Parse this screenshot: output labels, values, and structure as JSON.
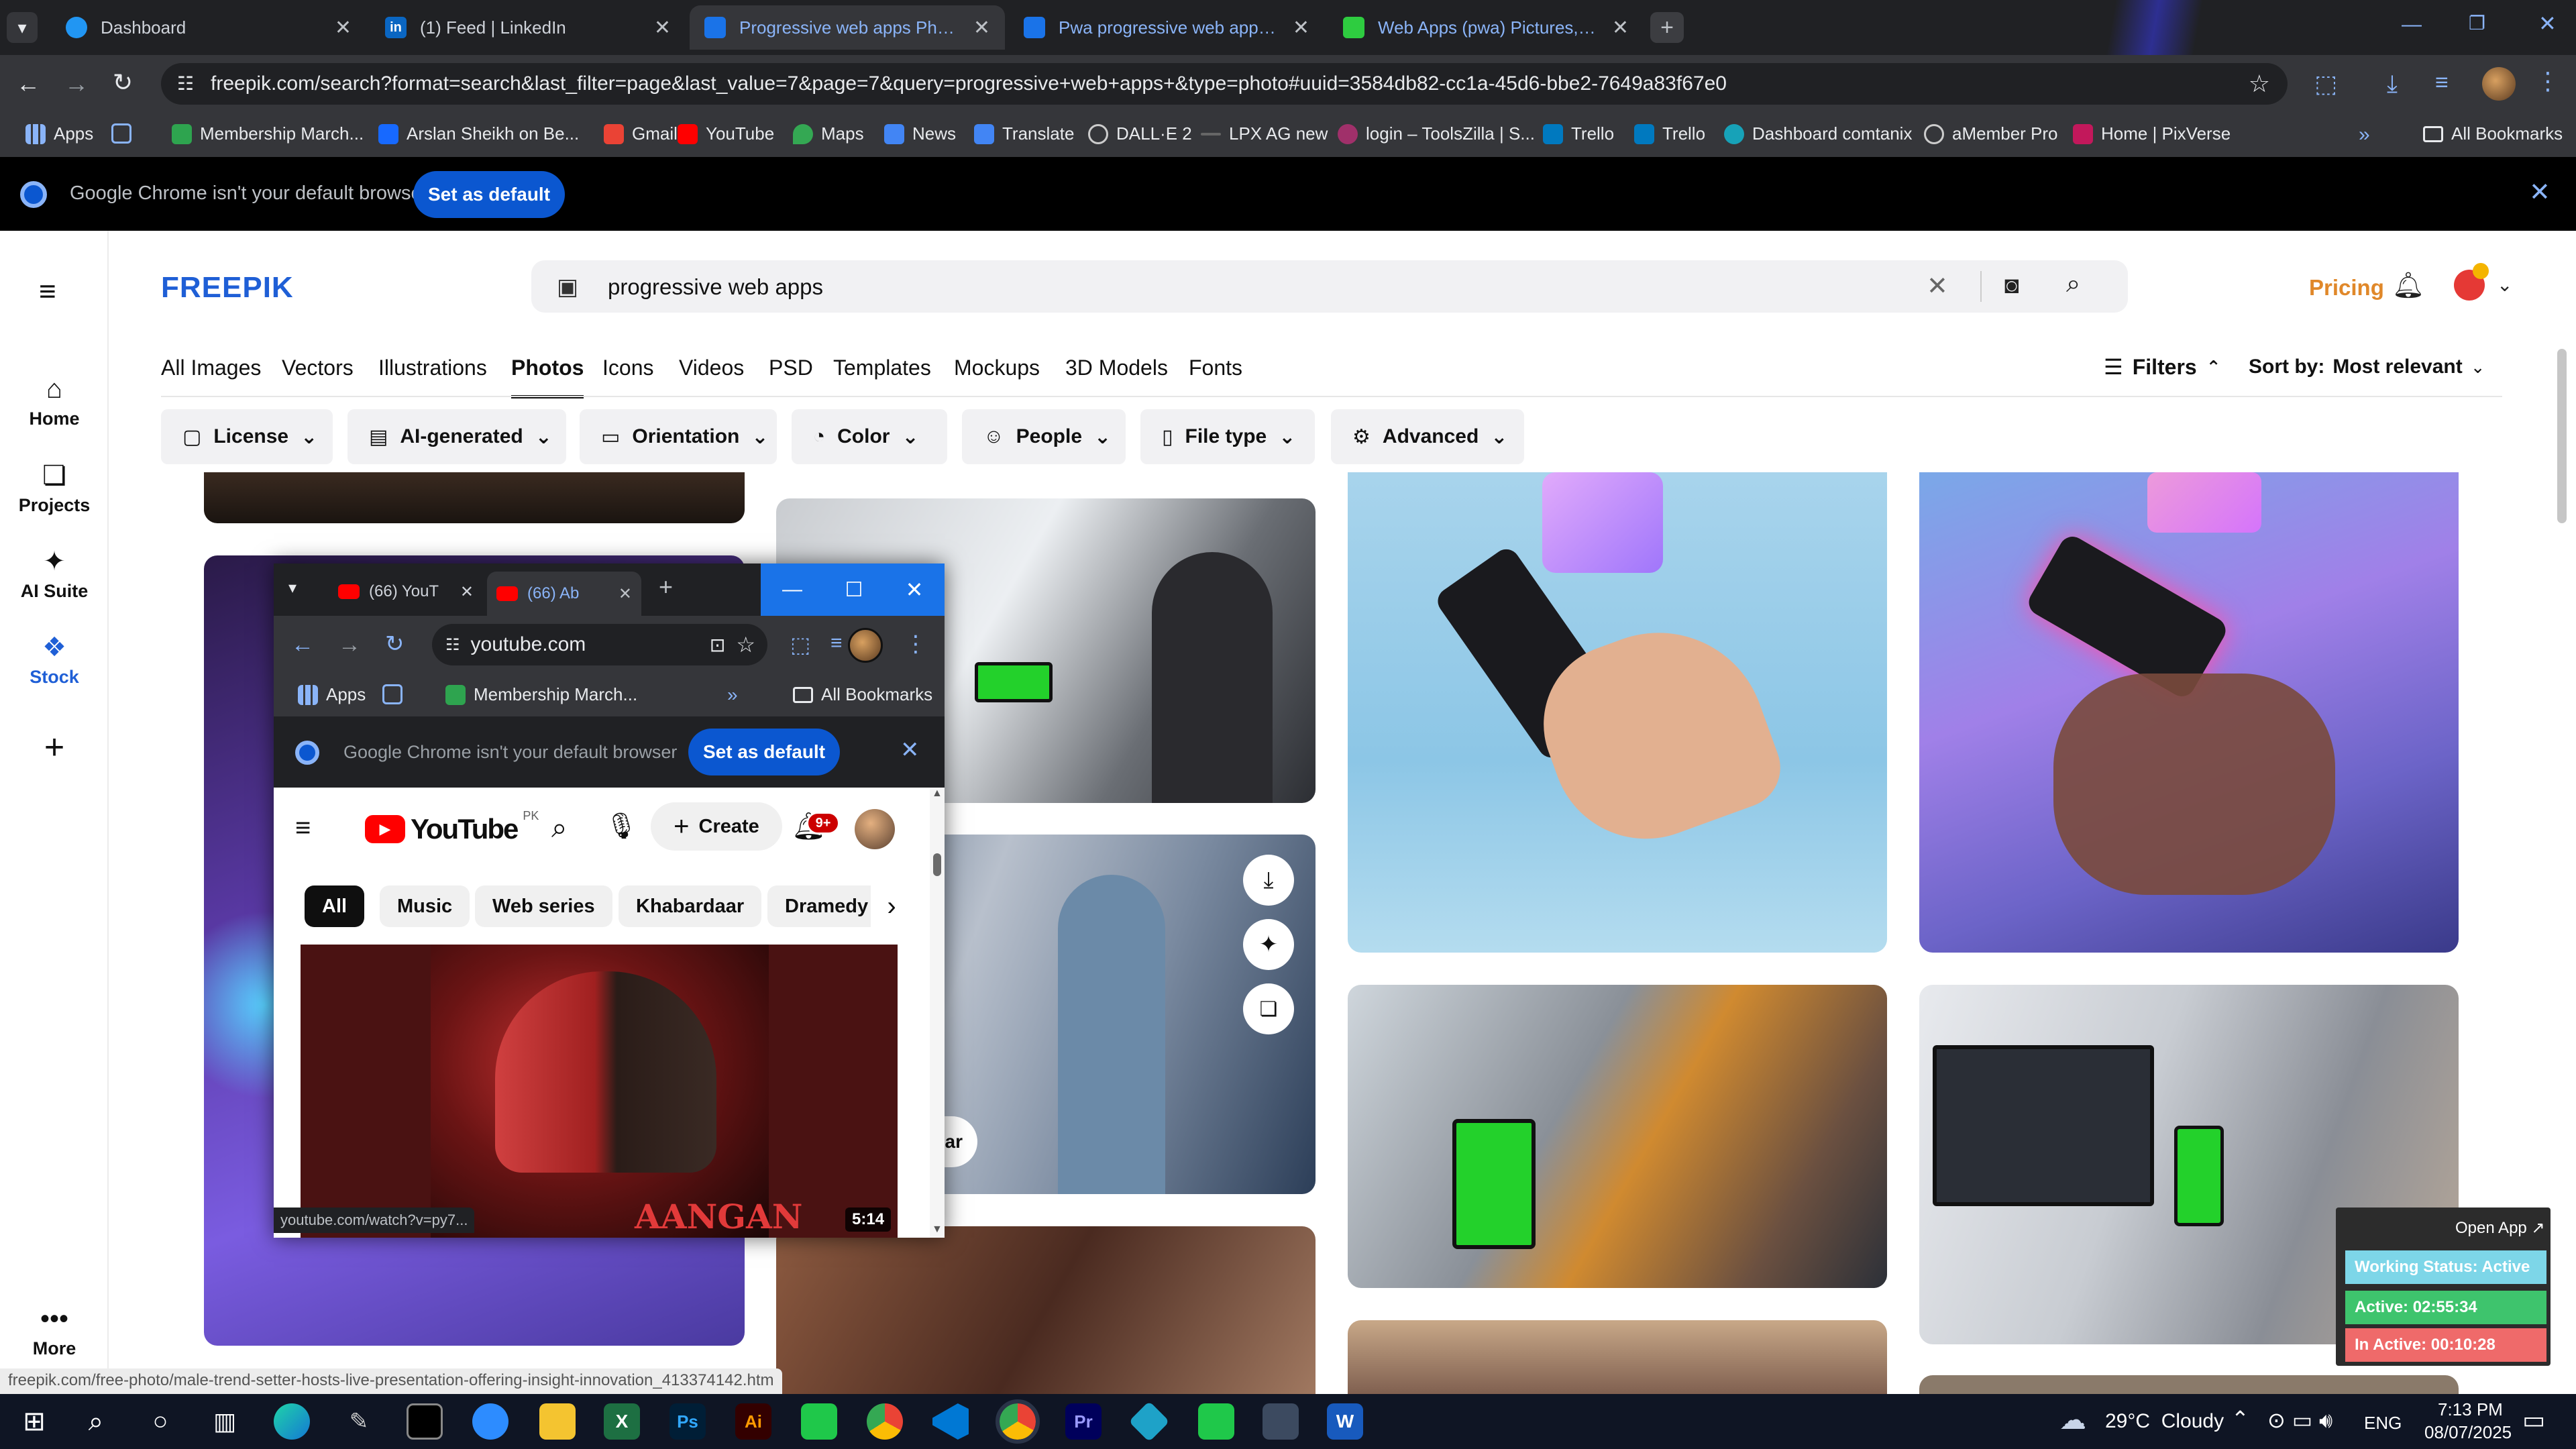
{
  "browser": {
    "tabs": [
      {
        "title": "Dashboard",
        "color": "#2196f3"
      },
      {
        "title": "(1) Feed | LinkedIn",
        "color": "#0a66c2"
      },
      {
        "title": "Progressive web apps Photos | Fr",
        "color": "#1a73e8"
      },
      {
        "title": "Pwa progressive web apps sma",
        "color": "#1a73e8"
      },
      {
        "title": "Web Apps (pwa) Pictures, Imag",
        "color": "#2ecc40"
      }
    ],
    "url": "freepik.com/search?format=search&last_filter=page&last_value=7&page=7&query=progressive+web+apps+&type=photo#uuid=3584db82-cc1a-45d6-bbe2-7649a83f67e0",
    "bookmarks": [
      {
        "label": "Apps",
        "color": "#8ab4f8"
      },
      {
        "label": "",
        "color": "#8ab4f8"
      },
      {
        "label": "Membership March...",
        "color": "#2ea44f"
      },
      {
        "label": "Arslan Sheikh on Be...",
        "color": "#1769ff"
      },
      {
        "label": "Gmail",
        "color": "#ea4335"
      },
      {
        "label": "YouTube",
        "color": "#ff0000"
      },
      {
        "label": "Maps",
        "color": "#34a853"
      },
      {
        "label": "News",
        "color": "#4285f4"
      },
      {
        "label": "Translate",
        "color": "#4285f4"
      },
      {
        "label": "DALL·E 2",
        "color": "#cccccc"
      },
      {
        "label": "LPX AG new",
        "color": "#666666"
      },
      {
        "label": "login – ToolsZilla | S...",
        "color": "#a0306a"
      },
      {
        "label": "Trello",
        "color": "#0079bf"
      },
      {
        "label": "Trello",
        "color": "#0079bf"
      },
      {
        "label": "Dashboard comtanix",
        "color": "#17a2b8"
      },
      {
        "label": "aMember Pro",
        "color": "#999999"
      },
      {
        "label": "Home | PixVerse",
        "color": "#c2185b"
      }
    ],
    "all_bookmarks": "All Bookmarks",
    "infobar_text": "Google Chrome isn't your default browser",
    "set_default": "Set as default"
  },
  "freepik": {
    "logo": "FREEPIK",
    "search_value": "progressive web apps",
    "pricing": "Pricing",
    "rail": [
      {
        "label": "Home",
        "icon": "home-icon"
      },
      {
        "label": "Projects",
        "icon": "projects-icon"
      },
      {
        "label": "AI Suite",
        "icon": "ai-suite-icon"
      },
      {
        "label": "Stock",
        "icon": "stock-icon"
      },
      {
        "label": "",
        "icon": "plus-icon"
      },
      {
        "label": "More",
        "icon": "more-icon"
      }
    ],
    "categories": [
      "All Images",
      "Vectors",
      "Illustrations",
      "Photos",
      "Icons",
      "Videos",
      "PSD",
      "Templates",
      "Mockups",
      "3D Models",
      "Fonts"
    ],
    "active_category": "Photos",
    "filters_label": "Filters",
    "sort_label": "Sort by:",
    "sort_value": "Most relevant",
    "filter_chips": [
      "License",
      "AI-generated",
      "Orientation",
      "Color",
      "People",
      "File type",
      "Advanced"
    ],
    "hover_similar": "ilar",
    "status_url": "freepik.com/free-photo/male-trend-setter-hosts-live-presentation-offering-insight-innovation_413374142.htm"
  },
  "youtube_window": {
    "tabs": [
      "(66) YouT",
      "(66) Ab"
    ],
    "url": "youtube.com",
    "bookmarks": [
      "Apps",
      "Membership March..."
    ],
    "all_bookmarks": "All Bookmarks",
    "infobar_text": "Google Chrome isn't your default browser",
    "set_default": "Set as default",
    "logo": "YouTube",
    "region": "PK",
    "create": "Create",
    "notif_count": "9+",
    "chips": [
      "All",
      "Music",
      "Web series",
      "Khabardaar",
      "Dramedy"
    ],
    "video_title": "AANGAN",
    "video_duration": "5:14",
    "hover_url": "youtube.com/watch?v=py7..."
  },
  "status_widget": {
    "open_app": "Open App ↗",
    "working": "Working Status: Active",
    "active": "Active: 02:55:34",
    "inactive": "In Active: 00:10:28"
  },
  "taskbar": {
    "weather": "29°C  Cloudy",
    "lang": "ENG",
    "time": "7:13 PM",
    "date": "08/07/2025"
  }
}
